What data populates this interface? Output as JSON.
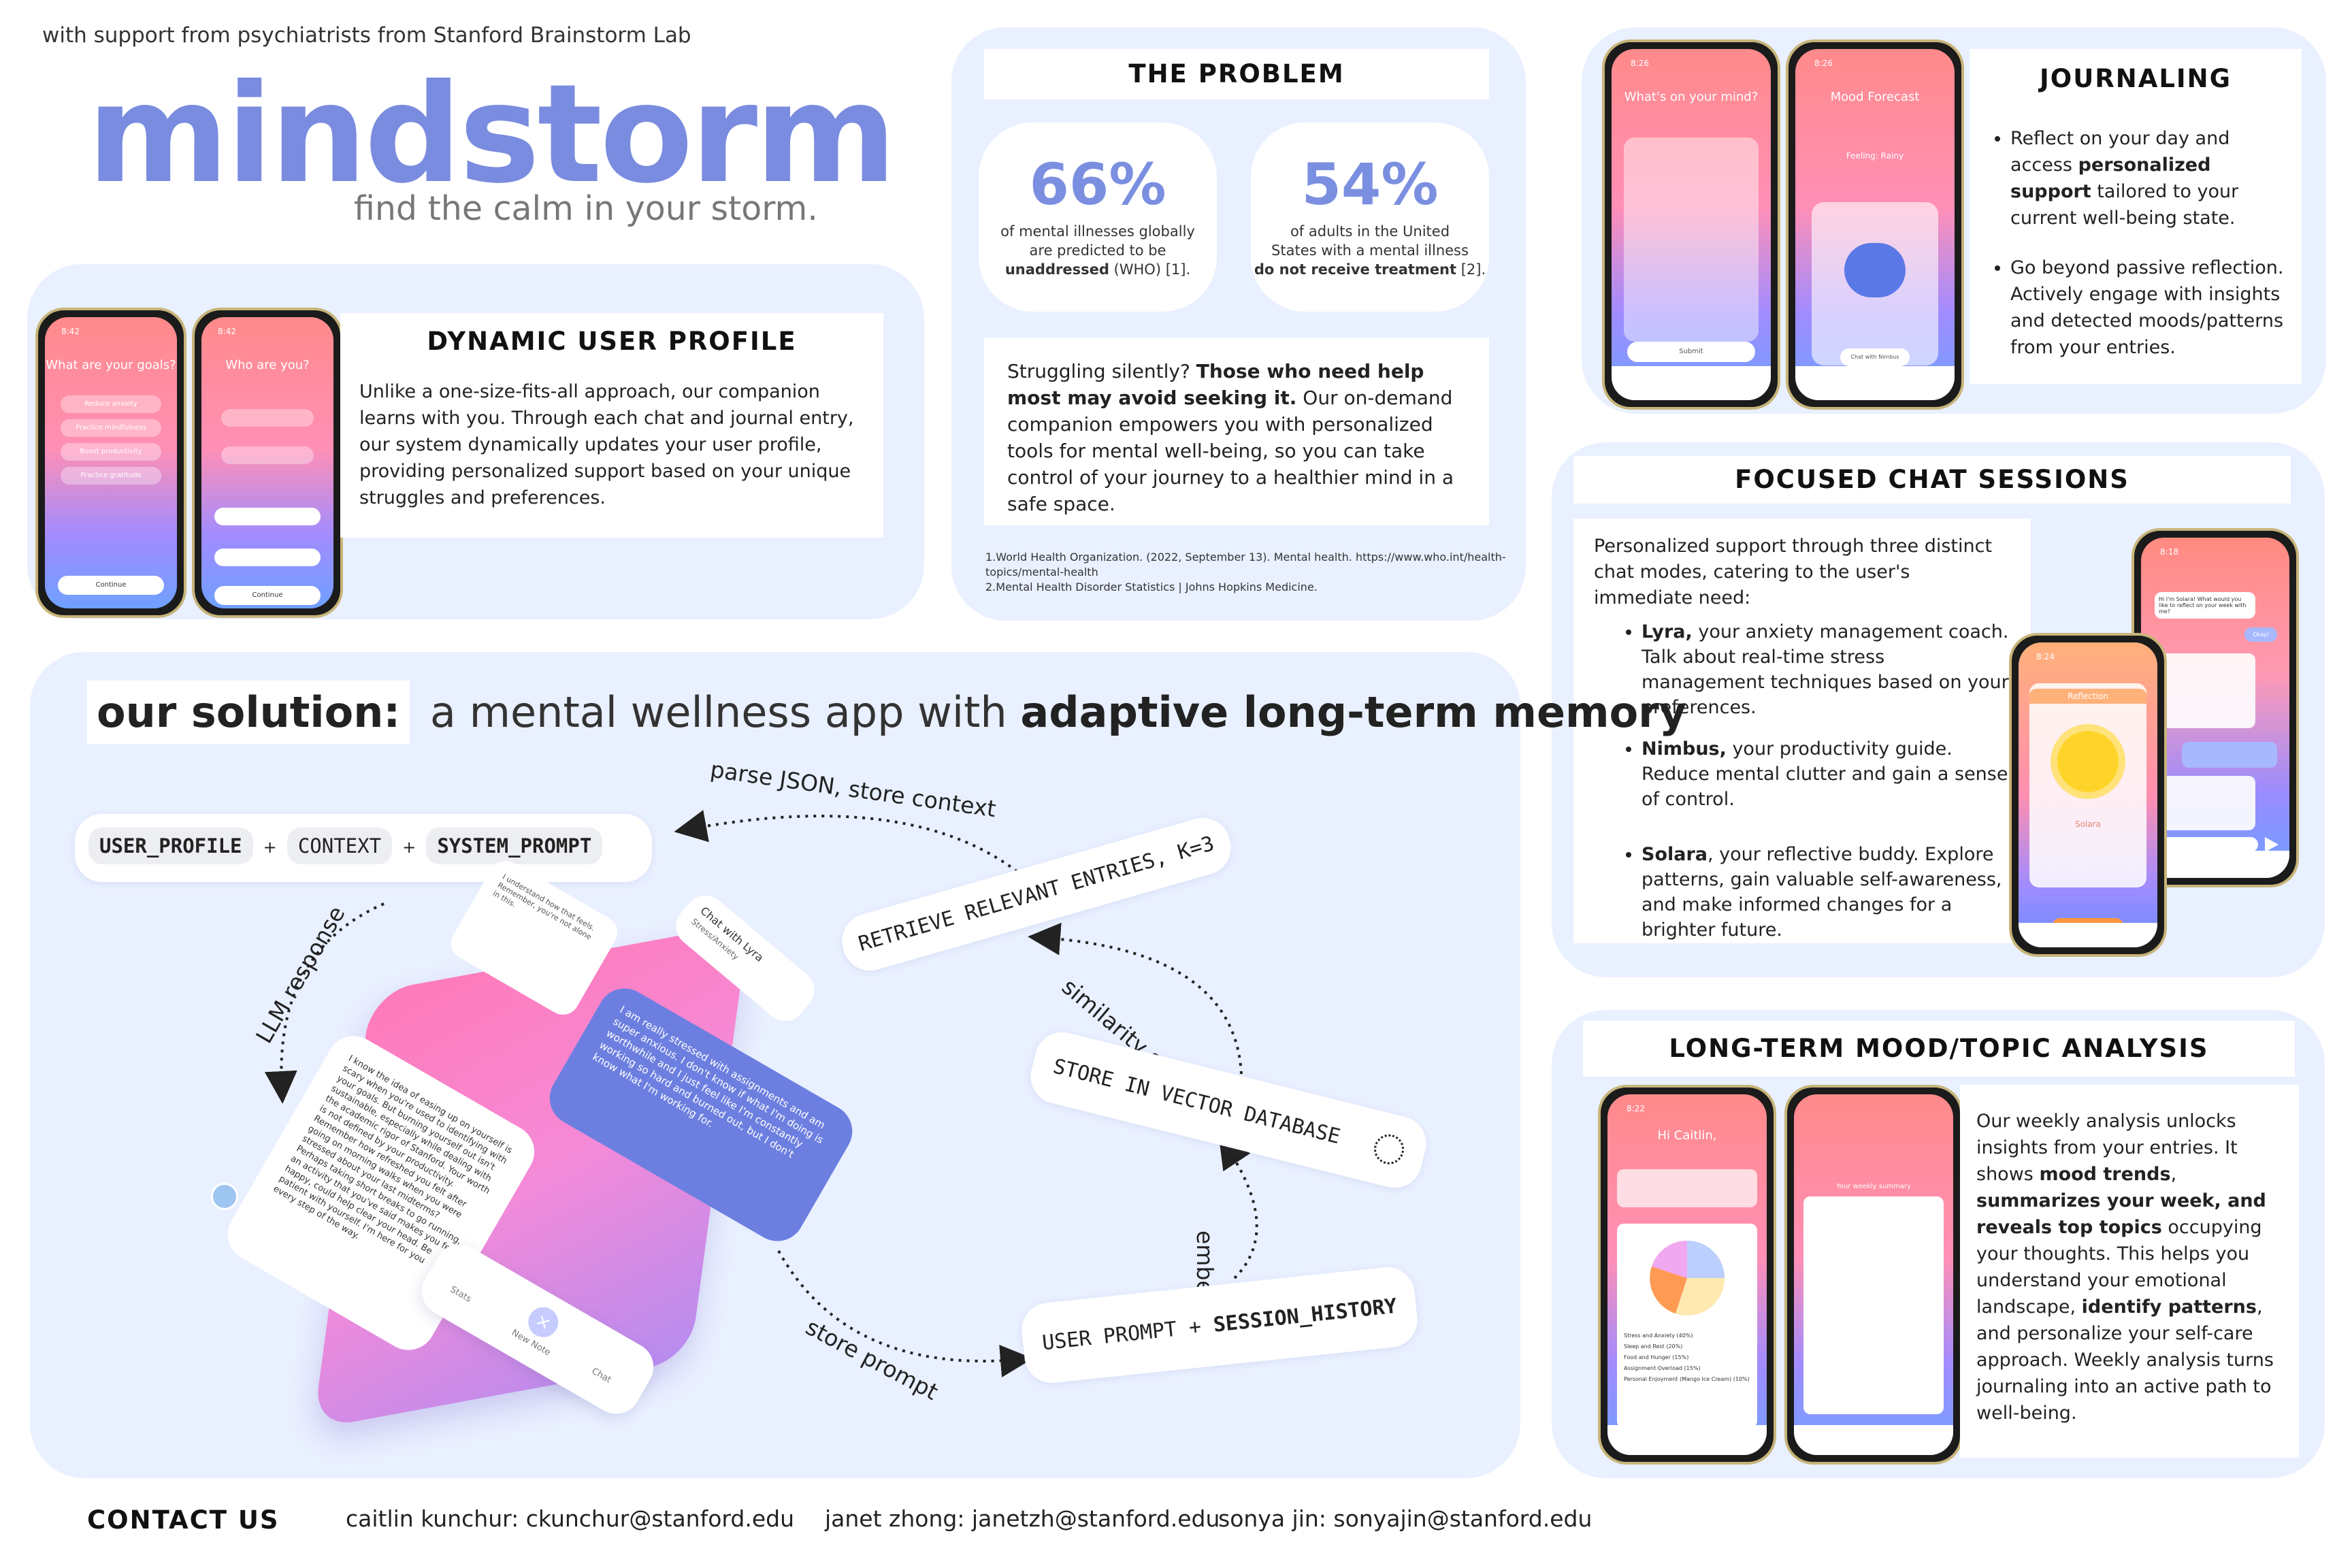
{
  "support_note": "with support from psychiatrists from Stanford Brainstorm Lab",
  "brand": {
    "name": "mindstorm",
    "tagline": "find the calm in your storm.",
    "color": "#7a8cdf"
  },
  "colors": {
    "panel": "#e9f0ff",
    "accent": "#7a8cdf",
    "stat": "#7b8fe0"
  },
  "profile": {
    "heading": "DYNAMIC USER PROFILE",
    "body": "Unlike a one-size-fits-all approach, our companion learns with you. Through each chat and journal entry, our system dynamically updates your user profile, providing personalized  support based on your unique struggles and preferences.",
    "phone1": {
      "time": "8:42",
      "title": "What are your goals?",
      "options": [
        "Reduce anxiety",
        "Practice mindfulness",
        "Boost productivity",
        "Practice gratitude"
      ],
      "button": "Continue"
    },
    "phone2": {
      "time": "8:42",
      "title": "Who are you?",
      "button": "Continue"
    }
  },
  "problem": {
    "heading": "THE PROBLEM",
    "stat1": {
      "value": "66%",
      "line1": "of mental illnesses globally",
      "line2": "are predicted to be",
      "bold": "unaddressed",
      "tail": " (WHO) [1]."
    },
    "stat2": {
      "value": "54%",
      "line1": "of adults in the United",
      "line2": "States with a mental illness",
      "bold": "do not receive treatment",
      "tail": "[2]."
    },
    "para_lead": "Struggling silently? ",
    "para_bold": "Those who need help most may avoid seeking it.",
    "para_rest": " Our on-demand companion empowers you with personalized tools for mental well-being, so you can take control of your journey to a healthier mind in a safe space.",
    "ref1": "1.World Health Organization. (2022, September 13). Mental health. https://www.who.int/health-topics/mental-health",
    "ref2": "2.Mental Health Disorder Statistics | Johns Hopkins Medicine."
  },
  "journaling": {
    "heading": "JOURNALING",
    "b1_pre": "Reflect on your day and access ",
    "b1_bold": "personalized support",
    "b1_post": " tailored to your current well-being state.",
    "b2": "Go beyond passive reflection. Actively engage with insights and detected moods/patterns from your entries.",
    "phone1": {
      "time": "8:26",
      "title": "What's on your mind?",
      "button": "Submit"
    },
    "phone2": {
      "time": "8:26",
      "title": "Mood Forecast",
      "feeling": "Feeling: Rainy",
      "button": "Chat with Nimbus"
    }
  },
  "chat": {
    "heading": "FOCUSED CHAT SESSIONS",
    "intro": "Personalized support through three distinct chat modes, catering to the user's immediate need:",
    "items": [
      {
        "name": "Lyra,",
        "text": " your anxiety management coach. Talk about real-time stress management techniques based on your preferences."
      },
      {
        "name": "Nimbus,",
        "text": " your productivity guide. Reduce mental clutter and gain a sense of control."
      },
      {
        "name": "Solara",
        "text": ", your reflective buddy. Explore patterns, gain valuable self-awareness, and make informed changes for a brighter future."
      }
    ],
    "phone1": {
      "time": "8:24",
      "title": "Reflection",
      "name": "Solara"
    },
    "phone2": {
      "time": "8:18",
      "greeting": "Hi I'm Solara! What would you like to reflect on your week with me?",
      "reply": "Okay!"
    }
  },
  "mood": {
    "heading": "LONG-TERM MOOD/TOPIC ANALYSIS",
    "p1": "Our weekly analysis unlocks insights from your entries. It shows ",
    "b1": "mood trends",
    "p2": ",",
    "b2": "summarizes your week, and reveals top topics",
    "p3": " occupying your thoughts. This helps you understand your emotional landscape, ",
    "b3": "identify patterns",
    "p4": ", and personalize your self-care approach. Weekly analysis turns journaling into an active path to well-being.",
    "phone1": {
      "time": "8:22",
      "greeting": "Hi Caitlin,",
      "legend": [
        "Stress and Anxiety (40%)",
        "Sleep and Rest (20%)",
        "Food and Hunger (15%)",
        "Assignment Overload (15%)",
        "Personal Enjoyment (Mango Ice Cream) (10%)"
      ]
    },
    "phone2": {
      "summary_title": "Your weekly summary"
    }
  },
  "solution": {
    "label": "our solution:",
    "pre": " a mental wellness app with ",
    "bold": "adaptive long-term memory",
    "chips": {
      "a": "USER_PROFILE",
      "plus1": "+",
      "b": "CONTEXT",
      "plus2": "+",
      "c": "SYSTEM_PROMPT"
    },
    "flow": {
      "parse": "parse JSON, store context",
      "retrieve": "RETRIEVE RELEVANT ENTRIES, K=3",
      "similarity": "similarity search",
      "store_vector": "STORE IN VECTOR DATABASE",
      "embed": "embed",
      "user_prompt": "USER PROMPT + ",
      "session": "SESSION_HISTORY",
      "store_prompt": "store prompt",
      "llm": "LLM response"
    },
    "chat_title": "Chat with Lyra",
    "chat_sub": "Stress/Anxiety",
    "bubble_user": "I am really stressed with assignments and am super anxious. I don't know if what I'm doing is worthwhile and I just feel like I'm constantly working so hard and burned out, but I don't know what I'm working for.",
    "bubble_bot": "I know the idea of easing up on yourself is scary when you're used to identifying with your goals. But burning yourself out isn't sustainable, especially while dealing with the academic rigor of Stanford. Your worth is not defined by your productivity. Remember how refreshed you felt after going on morning walks when you were stressed about your last midterms? Perhaps taking short breaks to go running, an activity that you've said makes you feel happy, could help clear your head. Be patient with yourself. I'm here for you every step of the way.",
    "card_small": "I understand how that feels. Remember, you're not alone in this.",
    "nav": {
      "stats": "Stats",
      "new_note": "New Note",
      "chat": "Chat"
    }
  },
  "contact": {
    "heading": "CONTACT US",
    "c1": "caitlin kunchur: ckunchur@stanford.edu",
    "c2": "janet zhong: janetzh@stanford.edu",
    "c3": "sonya jin: sonyajin@stanford.edu"
  }
}
